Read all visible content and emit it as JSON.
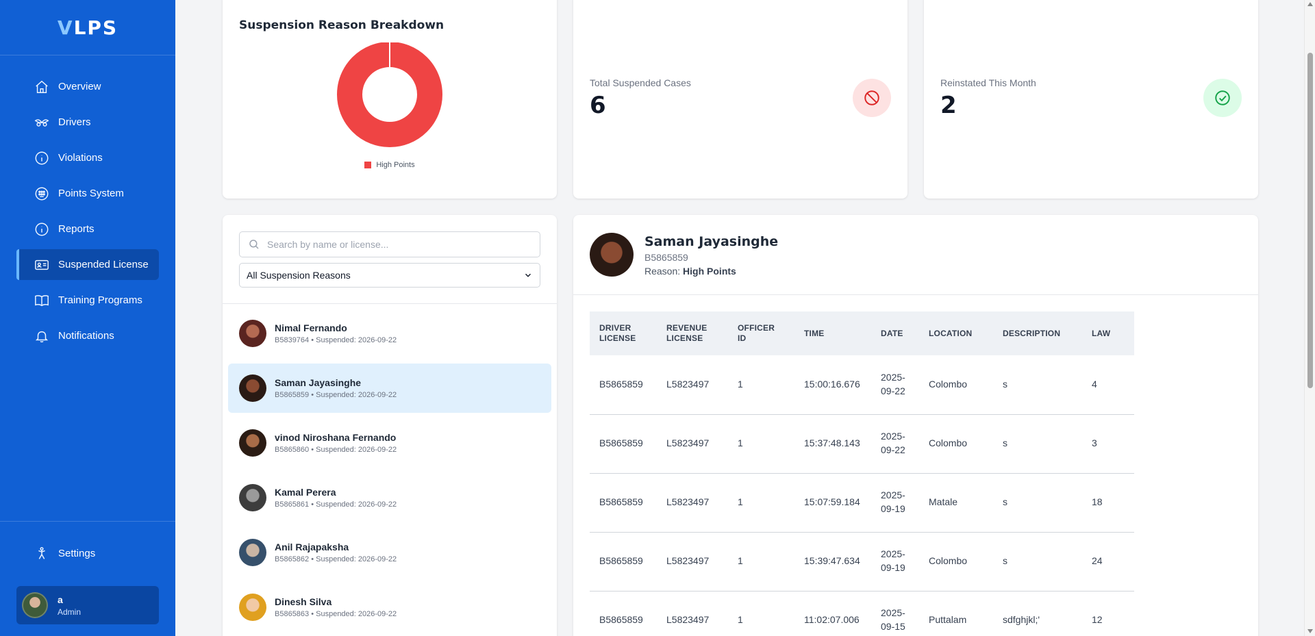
{
  "app": {
    "logo_first": "V",
    "logo_rest": "LPS"
  },
  "sidebar": {
    "items": [
      {
        "label": "Overview",
        "icon": "home-icon"
      },
      {
        "label": "Drivers",
        "icon": "drivers-icon"
      },
      {
        "label": "Violations",
        "icon": "info-icon"
      },
      {
        "label": "Points System",
        "icon": "points-icon"
      },
      {
        "label": "Reports",
        "icon": "info-icon"
      },
      {
        "label": "Suspended License",
        "icon": "id-card-icon",
        "active": true
      },
      {
        "label": "Training Programs",
        "icon": "book-icon"
      },
      {
        "label": "Notifications",
        "icon": "bell-icon"
      }
    ],
    "settings_label": "Settings",
    "user": {
      "name": "a",
      "role": "Admin"
    }
  },
  "chart_data": {
    "type": "pie",
    "title": "Suspension Reason Breakdown",
    "categories": [
      "High Points"
    ],
    "values": [
      6
    ],
    "colors": [
      "#ef4444"
    ],
    "donut": true,
    "legend": "bottom"
  },
  "stats": {
    "suspended": {
      "label": "Total Suspended Cases",
      "value": "6",
      "icon": "ban-icon"
    },
    "reinstated": {
      "label": "Reinstated This Month",
      "value": "2",
      "icon": "check-circle-icon"
    }
  },
  "list": {
    "search_placeholder": "Search by name or license...",
    "filter_value": "All Suspension Reasons",
    "drivers": [
      {
        "name": "Nimal Fernando",
        "sub": "B5839764 • Suspended: 2026-09-22"
      },
      {
        "name": "Saman Jayasinghe",
        "sub": "B5865859 • Suspended: 2026-09-22",
        "selected": true
      },
      {
        "name": "vinod Niroshana Fernando",
        "sub": "B5865860 • Suspended: 2026-09-22"
      },
      {
        "name": "Kamal Perera",
        "sub": "B5865861 • Suspended: 2026-09-22"
      },
      {
        "name": "Anil Rajapaksha",
        "sub": "B5865862 • Suspended: 2026-09-22"
      },
      {
        "name": "Dinesh Silva",
        "sub": "B5865863 • Suspended: 2026-09-22"
      }
    ]
  },
  "detail": {
    "name": "Saman Jayasinghe",
    "license": "B5865859",
    "reason_label": "Reason:",
    "reason_value": "High Points",
    "columns": [
      "Driver License",
      "Revenue License",
      "Officer ID",
      "Time",
      "Date",
      "Location",
      "Description",
      "Law"
    ],
    "rows": [
      [
        "B5865859",
        "L5823497",
        "1",
        "15:00:16.676",
        "2025-09-22",
        "Colombo",
        "s",
        "4"
      ],
      [
        "B5865859",
        "L5823497",
        "1",
        "15:37:48.143",
        "2025-09-22",
        "Colombo",
        "s",
        "3"
      ],
      [
        "B5865859",
        "L5823497",
        "1",
        "15:07:59.184",
        "2025-09-19",
        "Matale",
        "s",
        "18"
      ],
      [
        "B5865859",
        "L5823497",
        "1",
        "15:39:47.634",
        "2025-09-19",
        "Colombo",
        "s",
        "24"
      ],
      [
        "B5865859",
        "L5823497",
        "1",
        "11:02:07.006",
        "2025-09-15",
        "Puttalam",
        "sdfghjkl;'",
        "12"
      ]
    ]
  },
  "colors": {
    "sidebar": "#1160d4",
    "danger": "#ef4444",
    "success": "#16a34a",
    "selected_row": "#e0f0fd"
  }
}
